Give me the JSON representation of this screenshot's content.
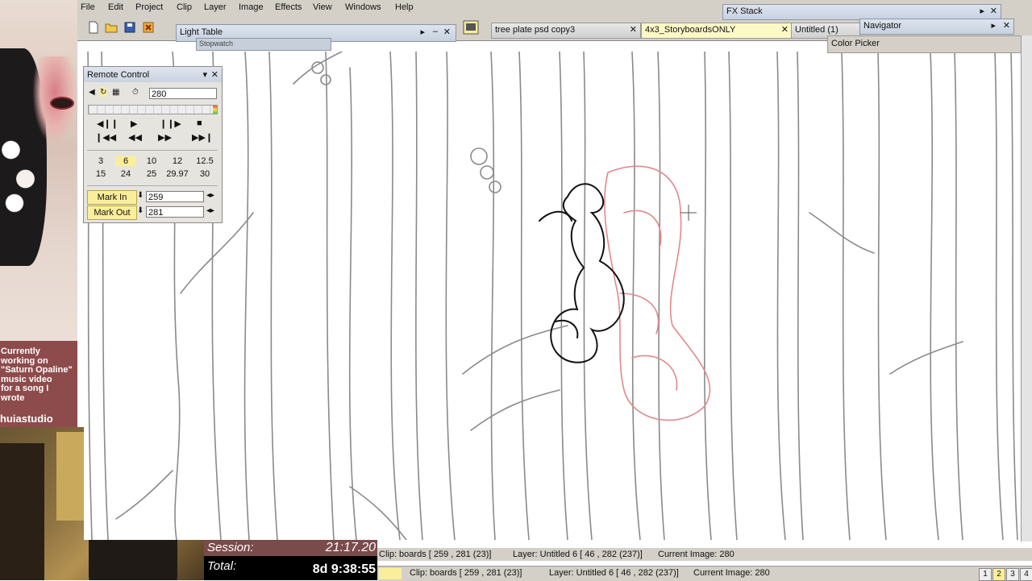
{
  "menu": [
    "File",
    "Edit",
    "Project",
    "Clip",
    "Layer",
    "Image",
    "Effects",
    "View",
    "Windows",
    "Help"
  ],
  "panels": {
    "light_table": "Light Table",
    "stopwatch": "Stopwatch",
    "fx_stack": "FX Stack",
    "navigator": "Navigator",
    "color_picker": "Color Picker"
  },
  "tabs": [
    "tree plate psd copy3",
    "4x3_StoryboardsONLY",
    "Untitled (1)"
  ],
  "active_tab_index": 1,
  "remote": {
    "title": "Remote Control",
    "frame": "280",
    "rates_row1": [
      "3",
      "6",
      "10",
      "12",
      "12.5"
    ],
    "rates_row2": [
      "15",
      "24",
      "25",
      "29.97",
      "30"
    ],
    "selected_rate": "6",
    "mark_in_label": "Mark In",
    "mark_in_value": "259",
    "mark_out_label": "Mark Out",
    "mark_out_value": "281"
  },
  "status": {
    "clip": "Clip: boards [ 259 , 281  (23)]",
    "layer": "Layer: Untitled 6 [ 46 , 282  (237)]",
    "current_image": "Current Image: 280"
  },
  "pages": [
    "1",
    "2",
    "3",
    "4"
  ],
  "active_page": "2",
  "overlay": {
    "message_lines": [
      "Currently",
      "working on",
      "\"Saturn Opaline\"",
      "music video",
      "for a song I",
      "wrote"
    ],
    "brand": "huiastudio",
    "session_label": "Session:",
    "session_value": "21:17.20",
    "total_label": "Total:",
    "total_value": "8d 9:38:55"
  },
  "colors": {
    "accent_yellow": "#fbee9a",
    "overlay_red": "#8e4b4b",
    "onion_red": "#e08a8a"
  },
  "icons": [
    "new-file-icon",
    "open-folder-icon",
    "save-icon",
    "close-icon",
    "monitor-icon",
    "play-icon",
    "stop-icon",
    "step-forward-icon",
    "step-back-icon",
    "fast-forward-icon",
    "rewind-icon",
    "loop-icon",
    "arrow-left-right-icon"
  ]
}
